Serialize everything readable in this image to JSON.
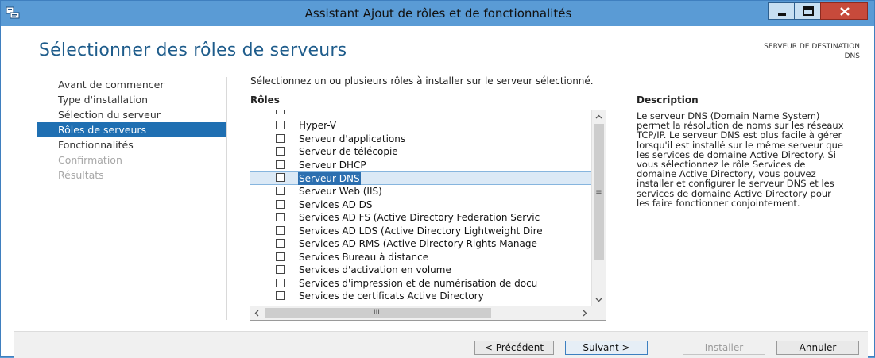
{
  "window": {
    "title": "Assistant Ajout de rôles et de fonctionnalités",
    "icons": {
      "app": "server-manager-icon",
      "minimize": "minimize-icon",
      "maximize": "maximize-icon",
      "close": "close-icon"
    }
  },
  "header": {
    "page_title": "Sélectionner des rôles de serveurs",
    "destination_label": "SERVEUR DE DESTINATION",
    "destination_value": "DNS"
  },
  "nav": {
    "items": [
      {
        "label": "Avant de commencer",
        "state": "normal"
      },
      {
        "label": "Type d'installation",
        "state": "normal"
      },
      {
        "label": "Sélection du serveur",
        "state": "normal"
      },
      {
        "label": "Rôles de serveurs",
        "state": "selected"
      },
      {
        "label": "Fonctionnalités",
        "state": "normal"
      },
      {
        "label": "Confirmation",
        "state": "disabled"
      },
      {
        "label": "Résultats",
        "state": "disabled"
      }
    ]
  },
  "main": {
    "instructions": "Sélectionnez un ou plusieurs rôles à installer sur le serveur sélectionné.",
    "roles_heading": "Rôles",
    "roles": [
      {
        "label": "Hyper-V",
        "checked": false
      },
      {
        "label": "Serveur d'applications",
        "checked": false
      },
      {
        "label": "Serveur de télécopie",
        "checked": false
      },
      {
        "label": "Serveur DHCP",
        "checked": false
      },
      {
        "label": "Serveur DNS",
        "checked": false
      },
      {
        "label": "Serveur Web (IIS)",
        "checked": false
      },
      {
        "label": "Services AD DS",
        "checked": false
      },
      {
        "label": "Services AD FS (Active Directory Federation Servic",
        "checked": false
      },
      {
        "label": "Services AD LDS (Active Directory Lightweight Dire",
        "checked": false
      },
      {
        "label": "Services AD RMS (Active Directory Rights Manage",
        "checked": false
      },
      {
        "label": "Services Bureau à distance",
        "checked": false
      },
      {
        "label": "Services d'activation en volume",
        "checked": false
      },
      {
        "label": "Services d'impression et de numérisation de docu",
        "checked": false
      },
      {
        "label": "Services de certificats Active Directory",
        "checked": false
      }
    ],
    "scroll_grip": "≡",
    "hscroll_grip": "III"
  },
  "description": {
    "heading": "Description",
    "text": "Le serveur DNS (Domain Name System) permet la résolution de noms sur les réseaux TCP/IP. Le serveur DNS est plus facile à gérer lorsqu'il est installé sur le même serveur que les services de domaine Active Directory. Si vous sélectionnez le rôle Services de domaine Active Directory, vous pouvez installer et configurer le serveur DNS et les services de domaine Active Directory pour les faire fonctionner conjointement."
  },
  "footer": {
    "prev_label": "< Précédent",
    "next_label": "Suivant >",
    "install_label": "Installer",
    "cancel_label": "Annuler"
  },
  "colors": {
    "title_bar": "#5a9bd5",
    "accent": "#1f6fb2",
    "page_title": "#1e5c8b"
  }
}
